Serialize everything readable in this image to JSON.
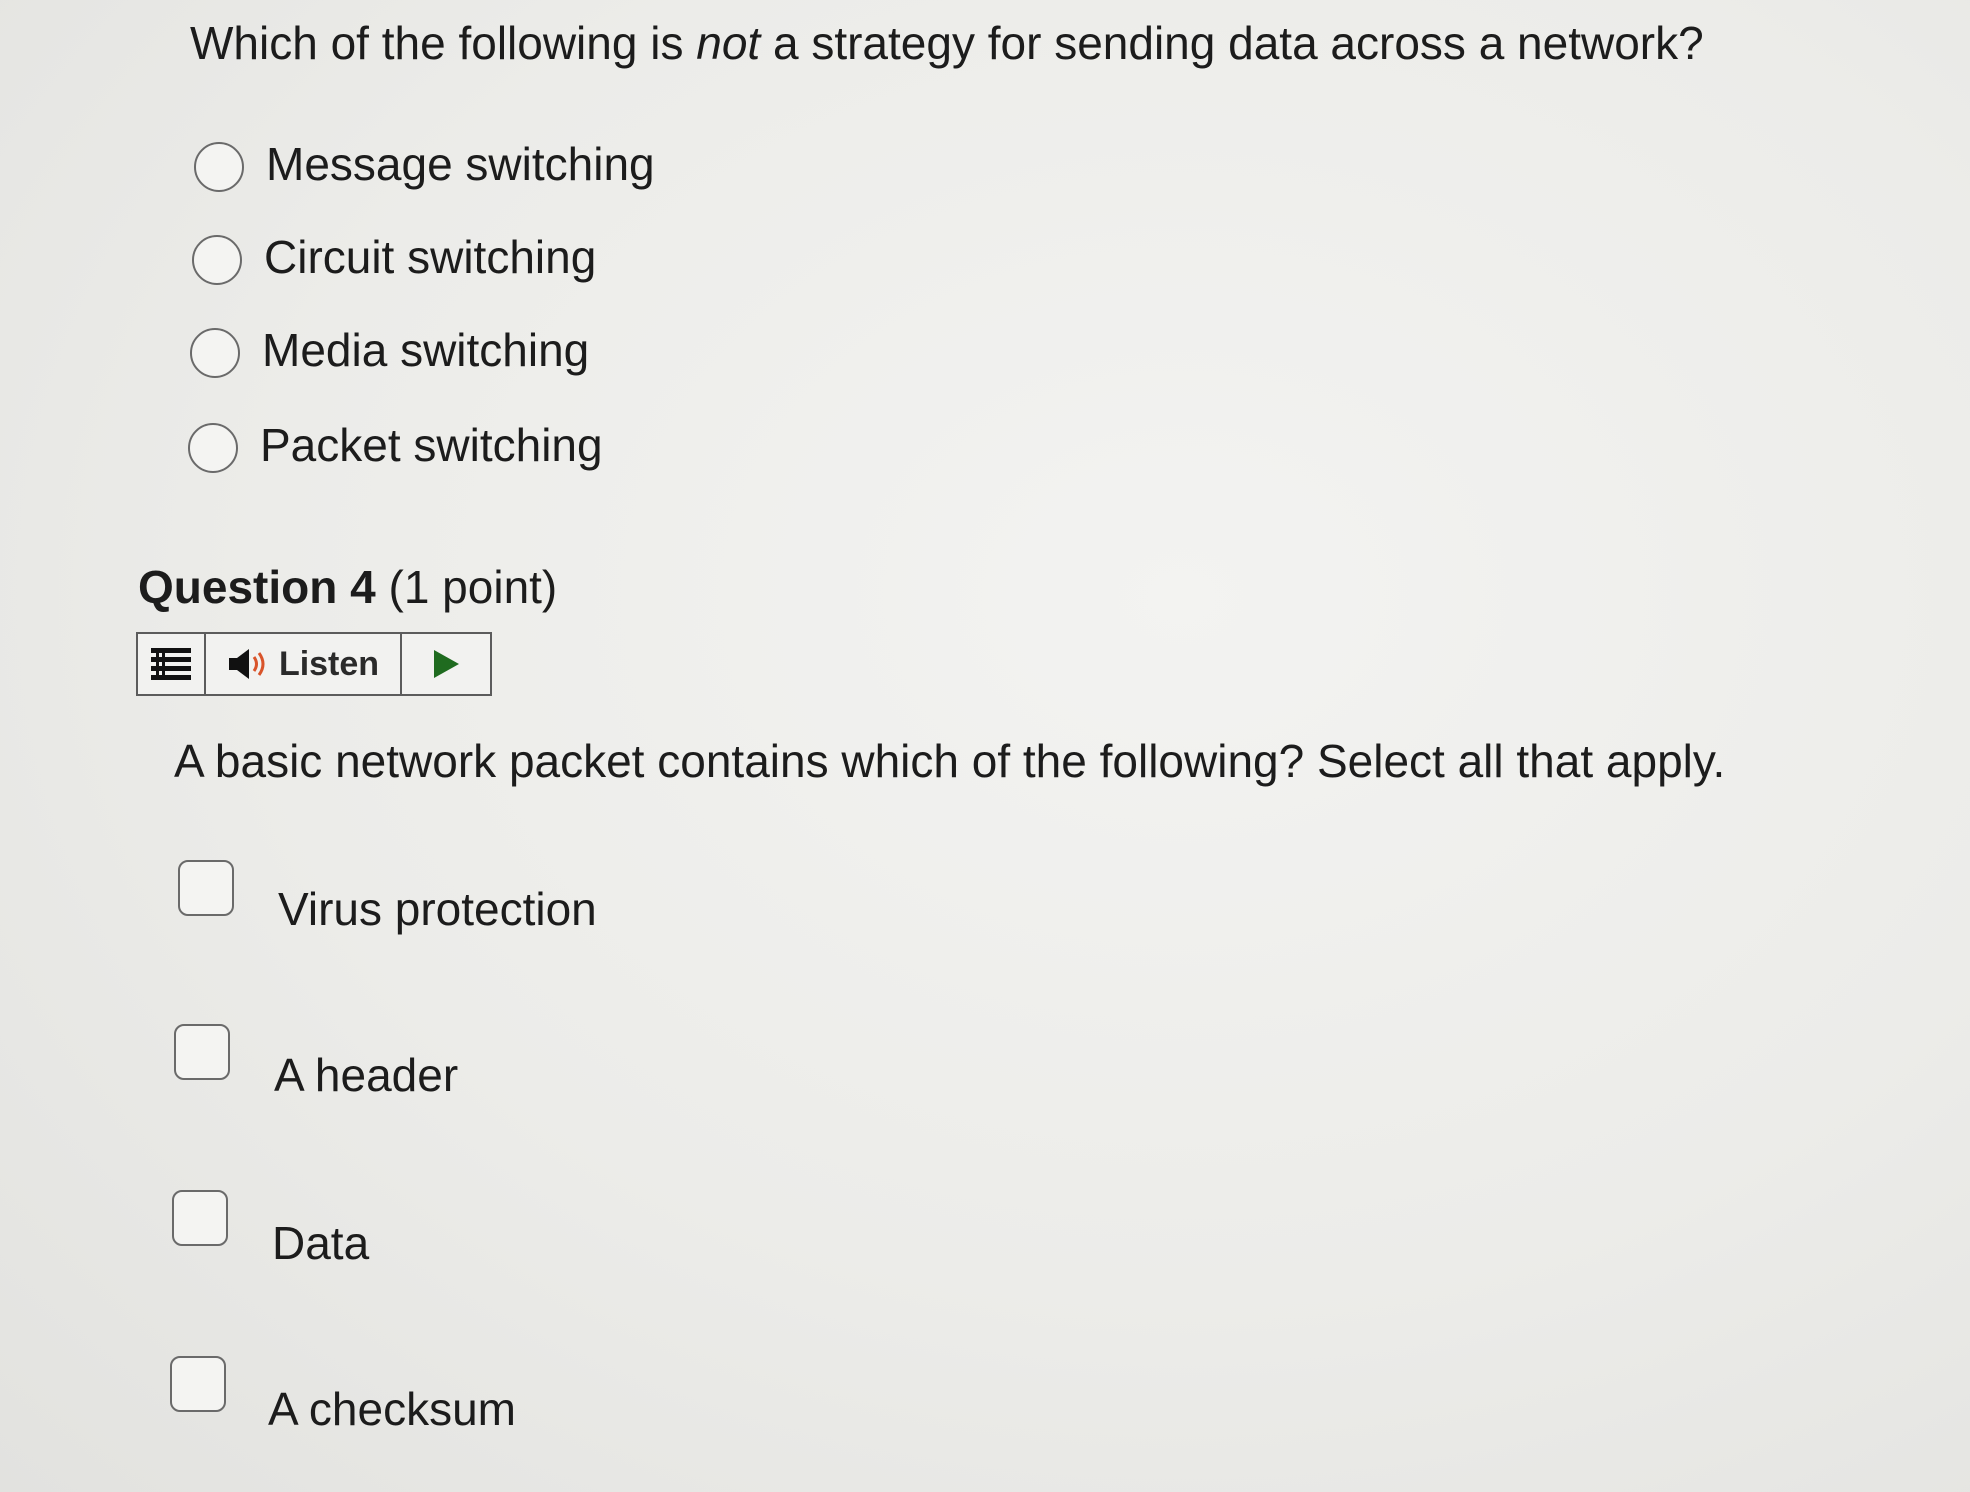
{
  "question3": {
    "text_before": "Which of the following is ",
    "text_emph": "not",
    "text_after": " a strategy for sending data across a network?",
    "options": [
      {
        "label": "Message switching"
      },
      {
        "label": "Circuit switching"
      },
      {
        "label": "Media switching"
      },
      {
        "label": "Packet switching"
      }
    ]
  },
  "question4": {
    "heading_bold": "Question 4",
    "heading_points": " (1 point)",
    "toolbar": {
      "menu_icon": "menu-lines-icon",
      "speaker_icon": "speaker-icon",
      "listen_label": "Listen",
      "play_icon": "play-icon"
    },
    "text": "A basic network packet contains which of the following? Select all that apply.",
    "options": [
      {
        "label": "Virus protection"
      },
      {
        "label": "A header"
      },
      {
        "label": "Data"
      },
      {
        "label": "A checksum"
      }
    ]
  }
}
